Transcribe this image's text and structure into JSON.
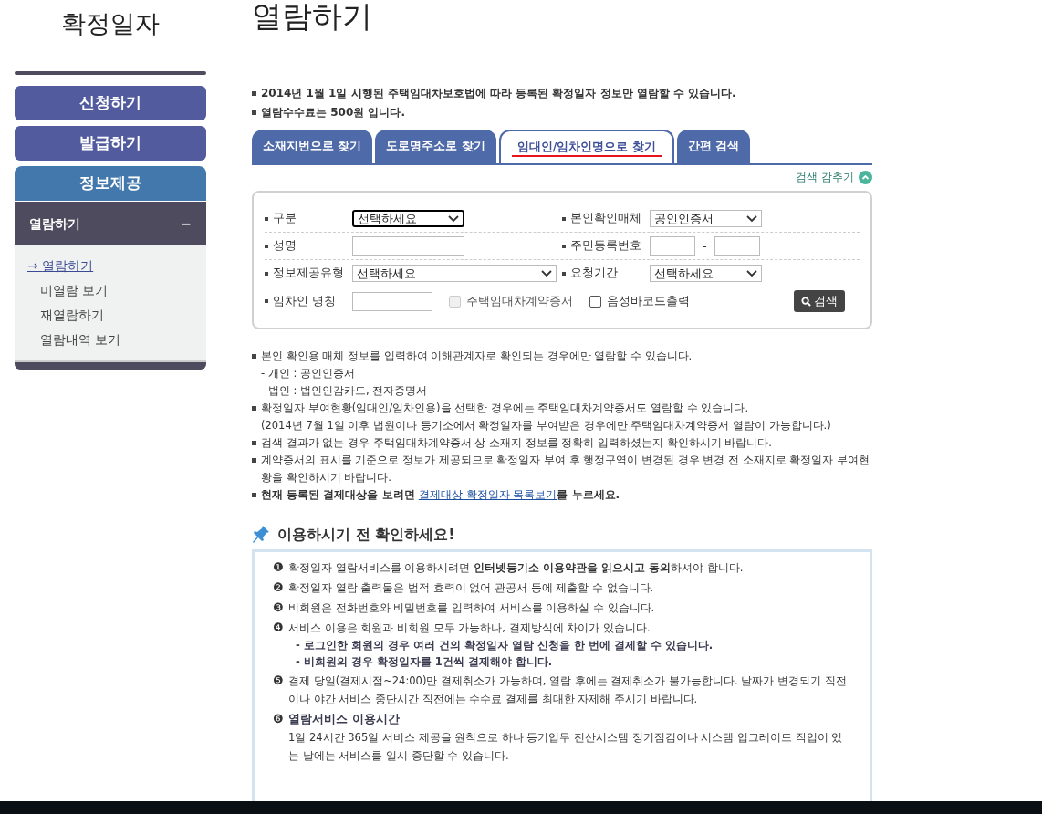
{
  "sidebar": {
    "title": "확정일자",
    "menu": [
      {
        "label": "신청하기",
        "selected": false
      },
      {
        "label": "발급하기",
        "selected": false
      },
      {
        "label": "정보제공",
        "selected": true
      }
    ],
    "section": {
      "label": "열람하기",
      "toggle": "−",
      "expanded": true
    },
    "submenu": [
      {
        "label": "열람하기",
        "selected": true,
        "marker": "→"
      },
      {
        "label": "미열람 보기",
        "selected": false
      },
      {
        "label": "재열람하기",
        "selected": false
      },
      {
        "label": "열람내역 보기",
        "selected": false
      }
    ]
  },
  "page_title": "열람하기",
  "intro": [
    "2014년 1월 1일 시행된 주택임대차보호법에 따라 등록된 확정일자 정보만 열람할 수 있습니다.",
    "열람수수료는 500원 입니다."
  ],
  "tabs": [
    {
      "label": "소재지번으로 찾기",
      "selected": false
    },
    {
      "label": "도로명주소로 찾기",
      "selected": false
    },
    {
      "label": "임대인/임차인명으로 찾기",
      "selected": true
    },
    {
      "label": "간편 검색",
      "selected": false
    }
  ],
  "hide_search": "검색 감추기",
  "form": [
    [
      {
        "label": "구분",
        "kind": "select",
        "value": "선택하세요",
        "wide": false,
        "focused": true
      },
      {
        "label": "본인확인매체",
        "kind": "select",
        "value": "공인인증서",
        "wide": false,
        "focused": false
      }
    ],
    [
      {
        "label": "성명",
        "kind": "input"
      },
      {
        "label": "주민등록번호",
        "kind": "ssn",
        "separator": "-"
      }
    ],
    [
      {
        "label": "정보제공유형",
        "kind": "select",
        "value": "선택하세요",
        "wide": true,
        "focused": false
      },
      {
        "label": "요청기간",
        "kind": "select",
        "value": "선택하세요",
        "wide": false,
        "focused": false
      }
    ],
    [
      {
        "label": "임차인 명칭",
        "kind": "input_checks",
        "checks": [
          {
            "label": "주택임대차계약증서",
            "checked": false,
            "disabled": true
          },
          {
            "label": "음성바코드출력",
            "checked": false,
            "disabled": false
          }
        ],
        "button": "검색"
      }
    ]
  ],
  "notes": [
    {
      "kind": "bullet",
      "text": "본인 확인용 매체 정보를 입력하여 이해관계자로 확인되는 경우에만 열람할 수 있습니다."
    },
    {
      "kind": "sub",
      "text": "- 개인 : 공인인증서"
    },
    {
      "kind": "sub",
      "text": "- 법인 : 법인인감카드, 전자증명서"
    },
    {
      "kind": "bullet",
      "text": "확정일자 부여현황(임대인/임차인용)을 선택한 경우에는 주택임대차계약증서도 열람할 수 있습니다."
    },
    {
      "kind": "sub",
      "text": "(2014년 7월 1일 이후 법원이나 등기소에서 확정일자를 부여받은 경우에만 주택임대차계약증서 열람이 가능합니다.)"
    },
    {
      "kind": "bullet",
      "text": "검색 결과가 없는 경우 주택임대차계약증서 상 소재지 정보를 정확히 입력하셨는지 확인하시기 바랍니다."
    },
    {
      "kind": "bullet",
      "text": "계약증서의 표시를 기준으로 정보가 제공되므로 확정일자 부여 후 행정구역이 변경된 경우 변경 전 소재지로 확정일자 부여현황을 확인하시기 바랍니다."
    },
    {
      "kind": "link",
      "before": "현재 등록된 결제대상을 보려면",
      "link": "결제대상 확정일자 목록보기",
      "after": "를 누르세요."
    }
  ],
  "check_title": "이용하시기 전 확인하세요!",
  "checks": [
    {
      "num": "❶",
      "text": "확정일자 열람서비스를 이용하시려면 **인터넷등기소 이용약관을 읽으시고 동의**하셔야 합니다."
    },
    {
      "num": "❷",
      "text": "확정일자 열람 출력물은 법적 효력이 없어 관공서 등에 제출할 수 없습니다."
    },
    {
      "num": "❸",
      "text": "비회원은 전화번호와 비밀번호를 입력하여 서비스를 이용하실 수 있습니다."
    },
    {
      "num": "❹",
      "text": "서비스 이용은 회원과 비회원 모두 가능하나, 결제방식에 차이가 있습니다.",
      "subs": [
        "- 로그인한 회원의 경우 여러 건의 확정일자 열람 신청을 한 번에 결제할 수 있습니다.",
        "- 비회원의 경우 확정일자를 1건씩 결제해야 합니다."
      ]
    },
    {
      "num": "❺",
      "text": "결제 당일(결제시점~24:00)만 결제취소가 가능하며, 열람 후에는 결제취소가 불가능합니다. 날짜가 변경되기 직전이나 야간 서비스 중단시간 직전에는 수수료 결제를 최대한 자제해 주시기 바랍니다."
    },
    {
      "num": "❻",
      "title": "열람서비스 이용시간",
      "text": "1일 24시간 365일 서비스 제공을 원칙으로 하나 등기업무 전산시스템 정기점검이나 시스템 업그레이드 작업이 있는 날에는 서비스를 일시 중단할 수 있습니다."
    }
  ]
}
